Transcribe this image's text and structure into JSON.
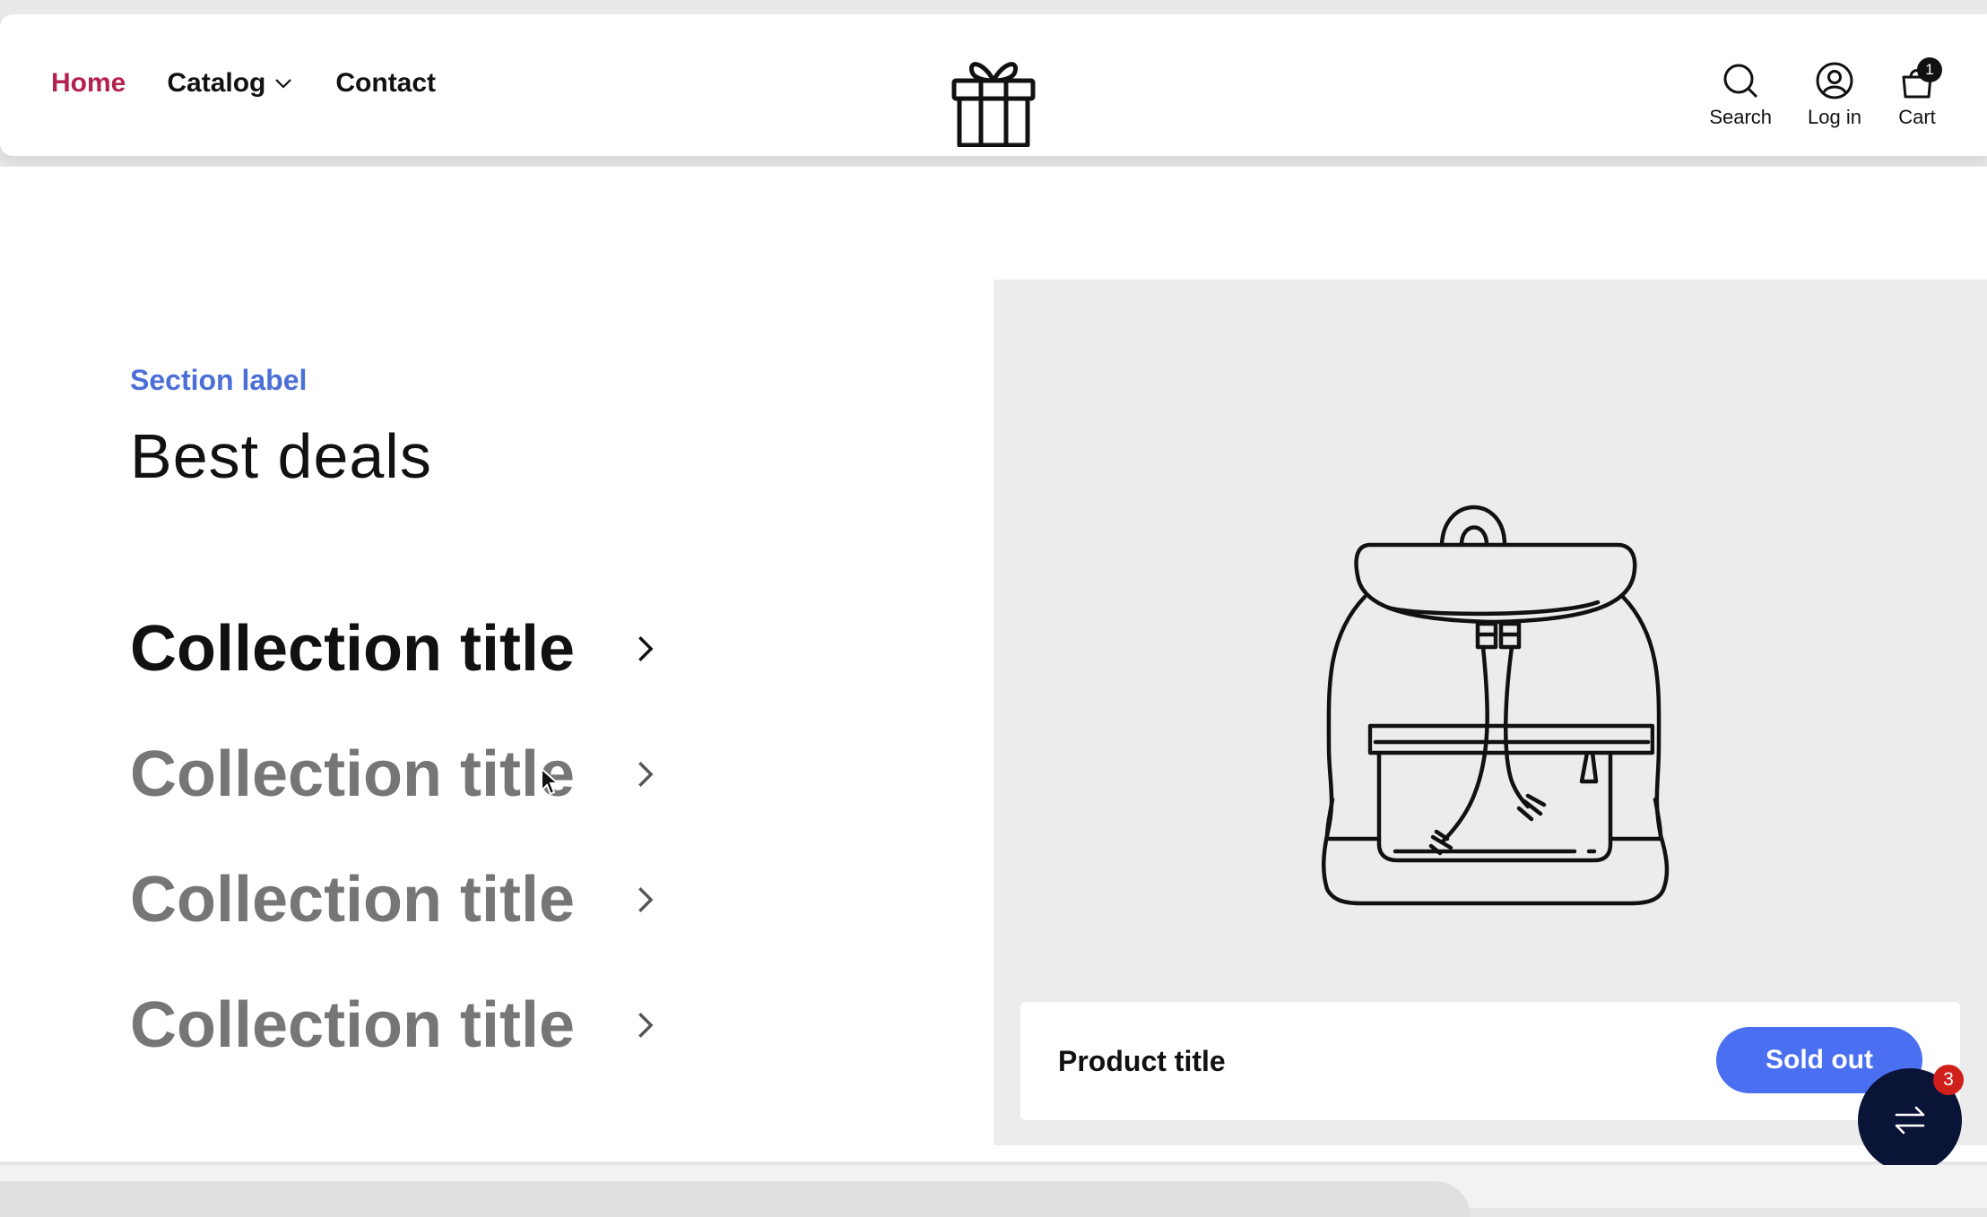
{
  "nav": {
    "home": "Home",
    "catalog": "Catalog",
    "contact": "Contact"
  },
  "header_icons": {
    "search": "Search",
    "login": "Log in",
    "cart": "Cart",
    "cart_count": "1"
  },
  "section": {
    "label": "Section label",
    "heading": "Best deals"
  },
  "collections": [
    {
      "title": "Collection title",
      "active": true
    },
    {
      "title": "Collection title",
      "active": false
    },
    {
      "title": "Collection title",
      "active": false
    },
    {
      "title": "Collection title",
      "active": false
    }
  ],
  "product": {
    "title": "Product title",
    "button": "Sold out"
  },
  "fab": {
    "badge": "3"
  },
  "colors": {
    "accent_nav": "#b3214f",
    "section_label": "#4b6fd6",
    "button": "#4a6ff0",
    "fab": "#0a1437",
    "badge_red": "#d0201c"
  },
  "icons": [
    "gift-logo-icon",
    "search-icon",
    "account-icon",
    "cart-icon",
    "chevron-down-icon",
    "chevron-right-icon",
    "swap-arrows-icon",
    "backpack-illustration"
  ]
}
